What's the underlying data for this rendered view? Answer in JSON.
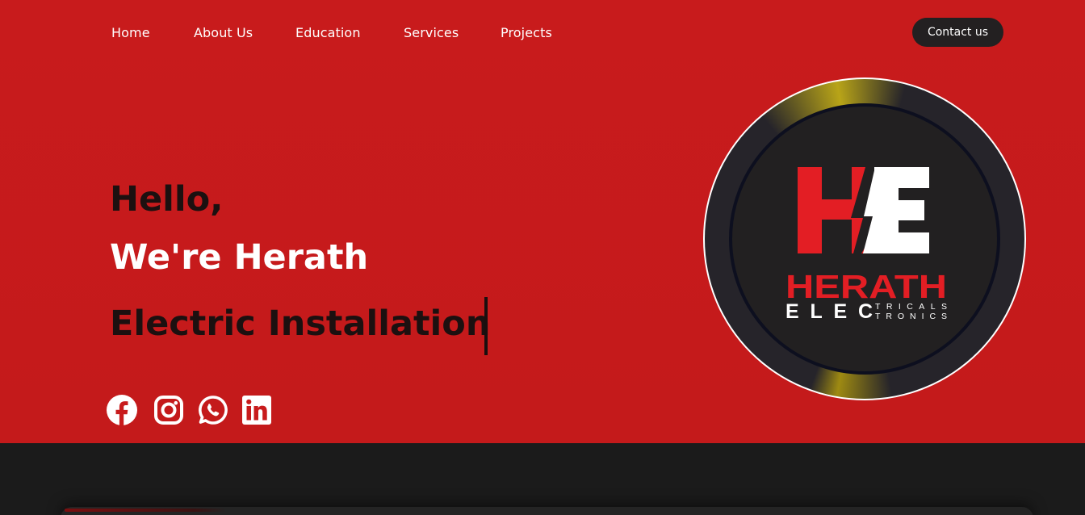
{
  "nav": {
    "items": [
      {
        "label": "Home"
      },
      {
        "label": "About Us"
      },
      {
        "label": "Education"
      },
      {
        "label": "Services"
      },
      {
        "label": "Projects"
      }
    ],
    "contact_label": "Contact us"
  },
  "hero": {
    "greeting": "Hello,",
    "intro": "We're Herath",
    "typed_text": "Electric Installation"
  },
  "social": [
    "facebook-icon",
    "instagram-icon",
    "whatsapp-icon",
    "linkedin-icon"
  ],
  "logo": {
    "monogram": "HE",
    "name": "HERATH",
    "word": "ELEC",
    "suffix_top": "TRICALS",
    "suffix_bottom": "TRONICS"
  },
  "colors": {
    "hero_bg": "#c81b1c",
    "dark_bg": "#1b1b1b",
    "button_bg": "#232021",
    "logo_red": "#e31e24",
    "text_dark": "#1c1010"
  }
}
